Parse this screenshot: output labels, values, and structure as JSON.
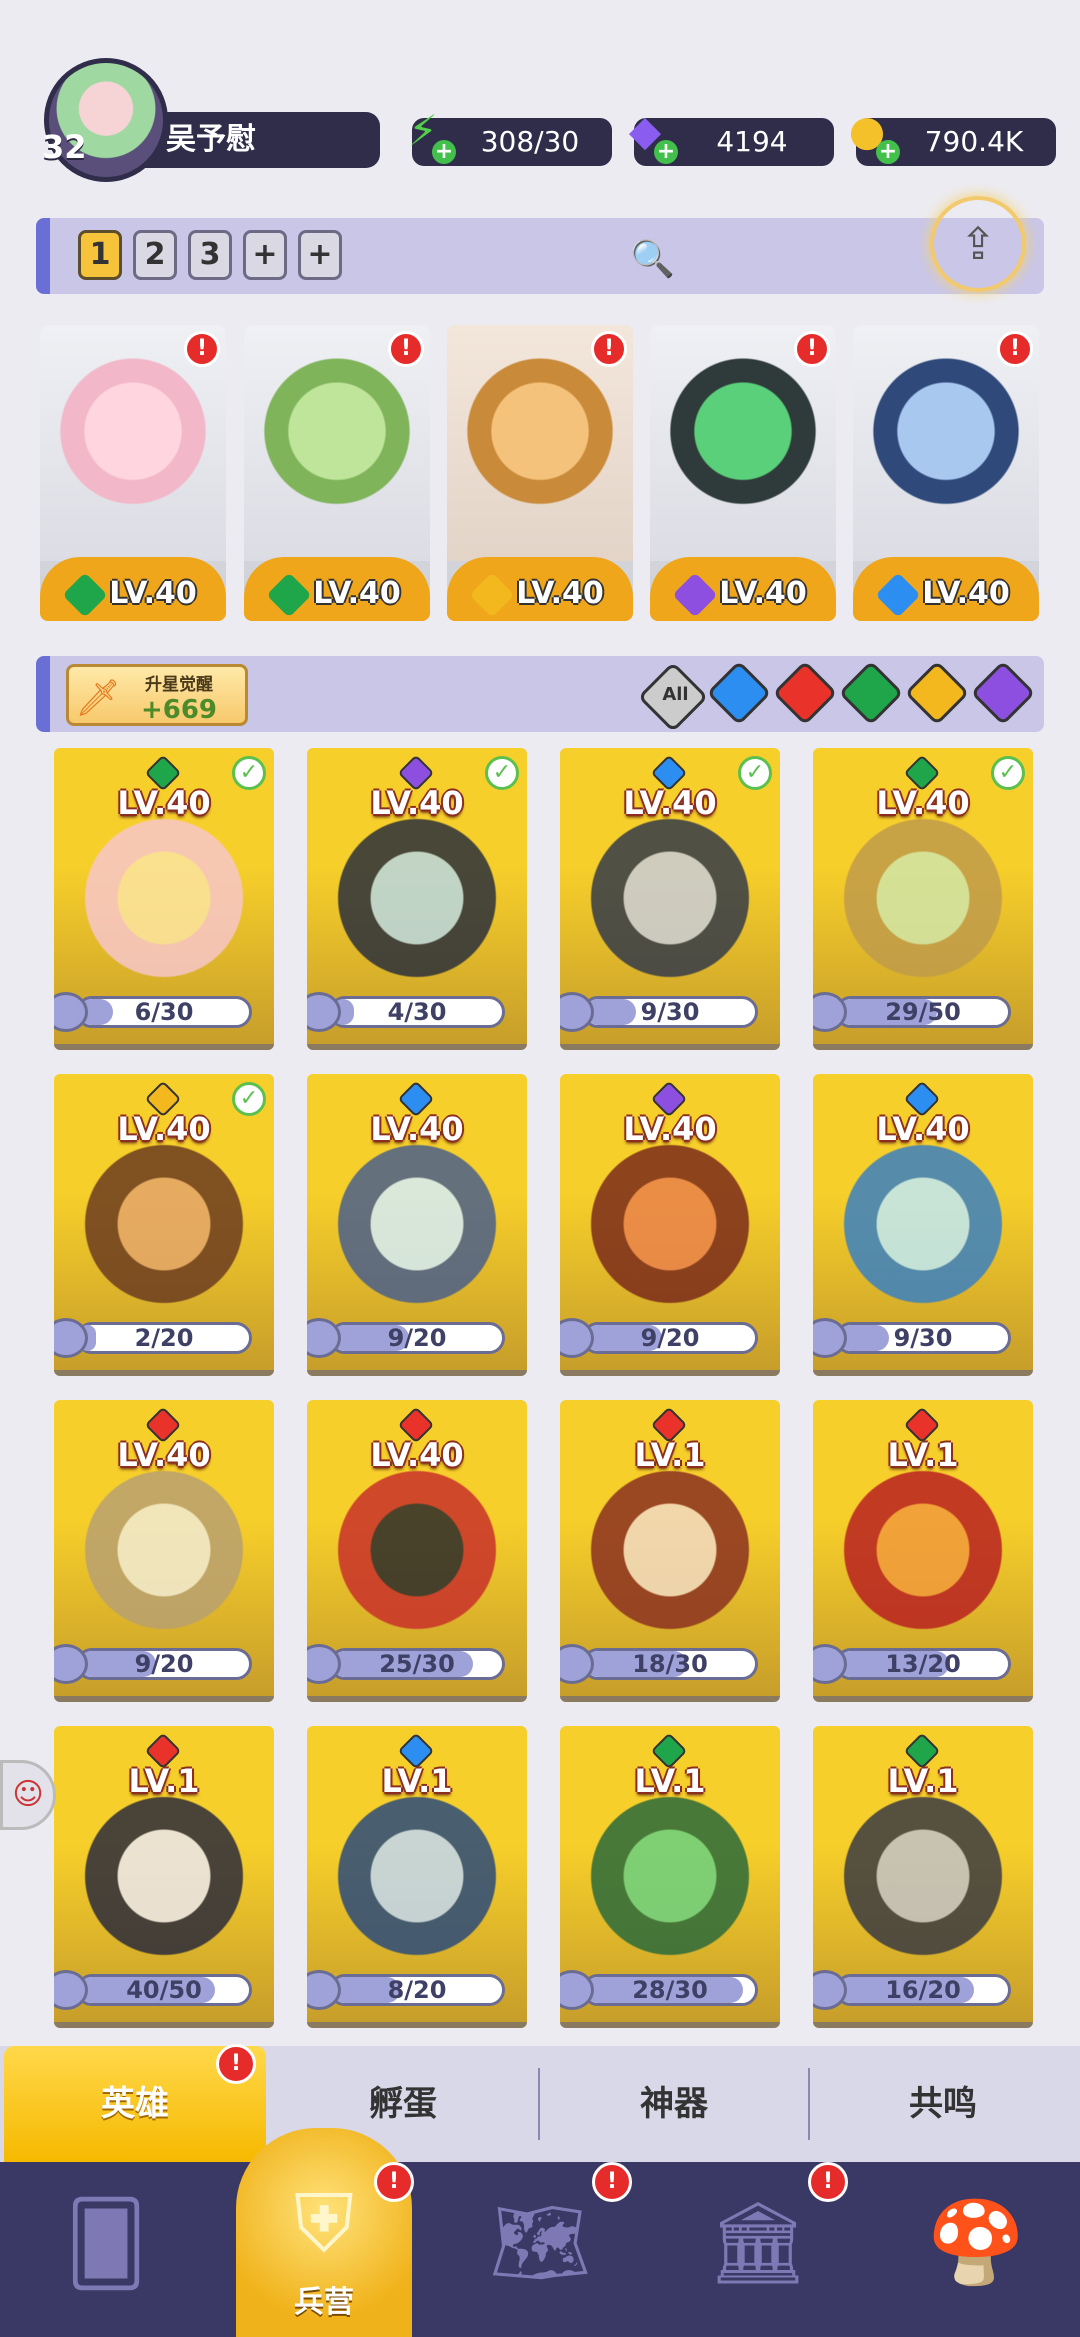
{
  "player": {
    "level": "32",
    "name": "吴予慰"
  },
  "resources": [
    {
      "name": "energy",
      "value": "308/30",
      "icon": "lightning-icon",
      "color": "#52d04a"
    },
    {
      "name": "gems",
      "value": "4194",
      "icon": "diamond-icon",
      "color": "#8a5cf0"
    },
    {
      "name": "gold",
      "value": "790.4K",
      "icon": "coin-icon",
      "color": "#f5c12b"
    }
  ],
  "teams": {
    "tabs": [
      "1",
      "2",
      "3",
      "+",
      "+"
    ],
    "active": "1"
  },
  "team_heroes": [
    {
      "level": "LV.40",
      "element": "green",
      "badge": "!"
    },
    {
      "level": "LV.40",
      "element": "green",
      "badge": "!"
    },
    {
      "level": "LV.40",
      "element": "gold",
      "badge": "!"
    },
    {
      "level": "LV.40",
      "element": "purple",
      "badge": "!"
    },
    {
      "level": "LV.40",
      "element": "blue",
      "badge": "!"
    }
  ],
  "awaken": {
    "title": "升星觉醒",
    "value": "+669"
  },
  "filters": {
    "all_label": "All",
    "elements": [
      "blue",
      "red",
      "green",
      "gold",
      "purple"
    ]
  },
  "heroes": [
    {
      "level": "LV.40",
      "element": "green",
      "checked": true,
      "progress": "6/30"
    },
    {
      "level": "LV.40",
      "element": "purple",
      "checked": true,
      "progress": "4/30"
    },
    {
      "level": "LV.40",
      "element": "blue",
      "checked": true,
      "progress": "9/30"
    },
    {
      "level": "LV.40",
      "element": "green",
      "checked": true,
      "progress": "29/50"
    },
    {
      "level": "LV.40",
      "element": "gold",
      "checked": true,
      "progress": "2/20"
    },
    {
      "level": "LV.40",
      "element": "blue",
      "checked": false,
      "progress": "9/20"
    },
    {
      "level": "LV.40",
      "element": "purple",
      "checked": false,
      "progress": "9/20"
    },
    {
      "level": "LV.40",
      "element": "blue",
      "checked": false,
      "progress": "9/30"
    },
    {
      "level": "LV.40",
      "element": "red",
      "checked": false,
      "progress": "9/20"
    },
    {
      "level": "LV.40",
      "element": "red",
      "checked": false,
      "progress": "25/30"
    },
    {
      "level": "LV.1",
      "element": "red",
      "checked": false,
      "progress": "18/30"
    },
    {
      "level": "LV.1",
      "element": "red",
      "checked": false,
      "progress": "13/20"
    },
    {
      "level": "LV.1",
      "element": "red",
      "checked": false,
      "progress": "40/50"
    },
    {
      "level": "LV.1",
      "element": "blue",
      "checked": false,
      "progress": "8/20"
    },
    {
      "level": "LV.1",
      "element": "green",
      "checked": false,
      "progress": "28/30"
    },
    {
      "level": "LV.1",
      "element": "green",
      "checked": false,
      "progress": "16/20"
    }
  ],
  "subtabs": [
    {
      "label": "英雄",
      "active": true,
      "badge": "!"
    },
    {
      "label": "孵蛋"
    },
    {
      "label": "神器"
    },
    {
      "label": "共鸣"
    }
  ],
  "nav": [
    {
      "icon": "cards-icon"
    },
    {
      "icon": "barracks-icon",
      "label": "兵营",
      "active": true,
      "badge": "!"
    },
    {
      "icon": "map-icon",
      "badge": "!"
    },
    {
      "icon": "castle-icon",
      "badge": "!"
    },
    {
      "icon": "mushroom-icon"
    }
  ],
  "colors": {
    "blue": "#2b8ef0",
    "red": "#e8322a",
    "green": "#1fa64a",
    "gold": "#f2b81d",
    "purple": "#8c4fe0"
  }
}
